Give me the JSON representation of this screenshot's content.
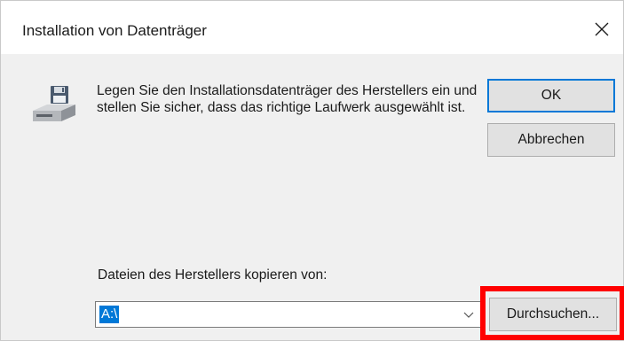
{
  "window": {
    "title": "Installation von Datenträger"
  },
  "icons": {
    "close": "close-icon",
    "drive": "disk-drive-icon",
    "dropdown": "chevron-down-icon"
  },
  "message": {
    "text": "Legen Sie den Installationsdatenträger des Herstellers ein und stellen Sie sicher, dass das richtige Laufwerk ausgewählt ist."
  },
  "buttons": {
    "ok_label": "OK",
    "cancel_label": "Abbrechen",
    "browse_label": "Durchsuchen..."
  },
  "source": {
    "label": "Dateien des Herstellers kopieren von:",
    "value": "A:\\"
  },
  "colors": {
    "accent": "#0078d7",
    "highlight": "#ff0000",
    "dialog_background": "#f0f0f0"
  }
}
